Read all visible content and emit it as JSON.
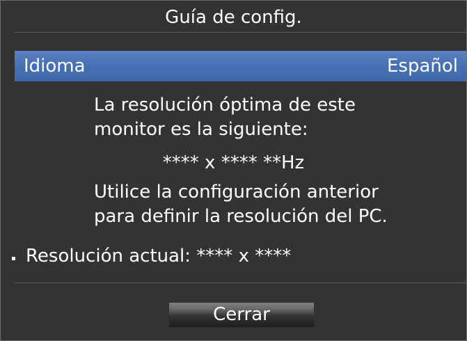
{
  "dialog": {
    "title": "Guía de config."
  },
  "language": {
    "label": "Idioma",
    "value": "Español"
  },
  "message": {
    "line1": "La resolución óptima de este\nmonitor es la siguiente:",
    "optimal_resolution": "**** x **** **Hz",
    "line2": "Utilice la configuración anterior\npara definir la resolución del PC."
  },
  "current_resolution": {
    "text": "Resolución actual: **** x ****"
  },
  "buttons": {
    "close_label": "Cerrar"
  },
  "colors": {
    "background": "#333333",
    "highlight": "#4670b3",
    "text": "#ffffff"
  }
}
